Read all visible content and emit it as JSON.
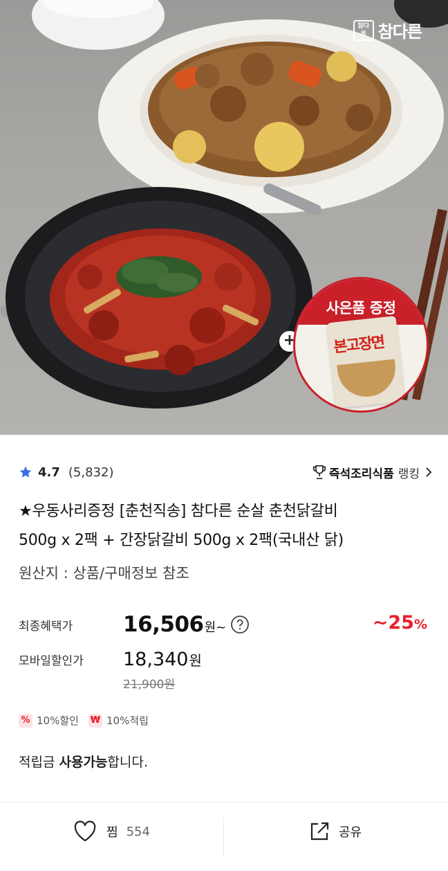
{
  "hero": {
    "brand_box": "참다른",
    "brand_name": "참다른",
    "gift_banner": "사은품 증정",
    "gift_pack_text": "본고장면",
    "plus": "+"
  },
  "rating": {
    "score": "4.7",
    "count": "(5,832)",
    "ranking_category": "즉석조리식품",
    "ranking_label": "랭킹"
  },
  "product": {
    "title_line1": "★우동사리증정 [춘천직송] 참다른 순살 춘천닭갈비",
    "title_line2": "500g x 2팩 + 간장닭갈비 500g x 2팩(국내산 닭)",
    "origin": "원산지 : 상품/구매정보 참조"
  },
  "price": {
    "final_label": "최종혜택가",
    "final_value": "16,506",
    "final_suffix": "원~",
    "discount_value": "~25",
    "discount_unit": "%",
    "mobile_label": "모바일할인가",
    "mobile_value": "18,340",
    "mobile_suffix": "원",
    "original": "21,900원"
  },
  "badges": [
    {
      "icon": "%",
      "label": "10%할인"
    },
    {
      "icon": "₩",
      "label": "10%적립"
    }
  ],
  "points": {
    "prefix": "적립금 ",
    "bold": "사용가능",
    "suffix": "합니다."
  },
  "bottom": {
    "wish_label": "찜",
    "wish_count": "554",
    "share_label": "공유"
  },
  "colors": {
    "accent_red": "#e8202a",
    "star_blue": "#3b6fe0",
    "gift_red": "#c9202a"
  }
}
